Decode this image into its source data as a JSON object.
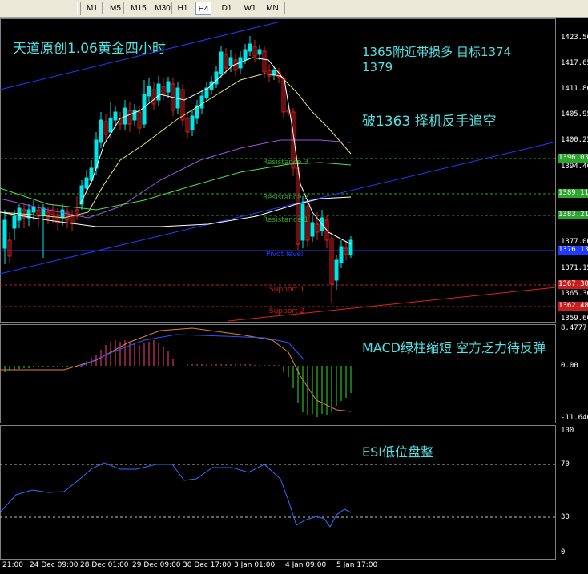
{
  "toolbar": {
    "timeframes": [
      "M1",
      "M5",
      "M15",
      "M30",
      "H1",
      "H4",
      "D1",
      "W1",
      "MN"
    ],
    "active": "H4"
  },
  "colors": {
    "bull": "#00E5E5",
    "bear": "#DC1E1E",
    "accent_text": "#4FE3E3",
    "pivot": "#1E3CFF",
    "resistance": "#2BA52B",
    "support": "#C81E1E"
  },
  "annotations": {
    "title": "天道原创1.06黄金四小时",
    "line1": "1365附近带损多   目标1374",
    "line2": "1379",
    "line3": "破1363 择机反手追空",
    "macd_note": "MACD绿柱缩短 空方乏力待反弹",
    "esi_note": "ESI低位盘整"
  },
  "levels": {
    "resistance3": "Resistance 3",
    "resistance2": "Resistance 2",
    "resistance1": "Resistance 1",
    "pivot": "Pivot level",
    "support1": "Support 1",
    "support2": "Support 2"
  },
  "price_axis": [
    "1423.50",
    "1417.65",
    "1411.80",
    "1405.95",
    "1400.25",
    "1394.40",
    "1377.00",
    "1371.15",
    "1365.30",
    "1359.60"
  ],
  "price_tags": {
    "r3": "1396.03",
    "r2": "1389.11",
    "r1": "1383.21",
    "current": "1376.13",
    "s1": "1367.30",
    "s2": "1362.48"
  },
  "macd_axis": [
    "8.4777",
    "0.00",
    "-11.6464"
  ],
  "esi_axis": [
    "100",
    "70",
    "30",
    "0"
  ],
  "time_axis": [
    "21:00",
    "24 Dec 09:00",
    "28 Dec 01:00",
    "29 Dec 09:00",
    "30 Dec 17:00",
    "3 Jan 01:00",
    "4 Jan 09:00",
    "5 Jan 17:00"
  ]
}
